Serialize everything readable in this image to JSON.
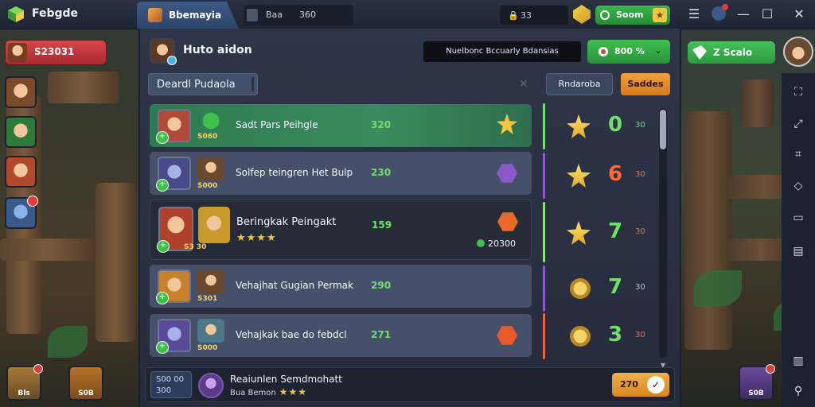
{
  "app": {
    "title": "Febgde"
  },
  "topbar": {
    "active_tab": "Bbemayia",
    "tab2_a": "Baa",
    "tab2_b": "360",
    "coin_value": "33",
    "green_pill_label": "Soom",
    "window_controls": [
      "menu-icon",
      "minimize-icon",
      "maximize-icon",
      "close-icon"
    ]
  },
  "left": {
    "player_value": "S23031",
    "bottom_tiles": [
      {
        "label": "Bls"
      },
      {
        "label": "S0B"
      }
    ]
  },
  "panel": {
    "header_title": "Huto aidon",
    "header_banner": "Nuelbonc Bccuarly Bdansias",
    "header_green_label": "800 %",
    "filter_label": "Deardl Pudaola",
    "btn_dark": "Rndaroba",
    "btn_orange": "Saddes",
    "rows": [
      {
        "hero_label": "S060",
        "name": "Sadt Pars Peihgle",
        "num": "320",
        "badge_color": "#f5c542",
        "style": "hl"
      },
      {
        "hero_label": "S000",
        "name": "Solfep teingren Het Bulp",
        "num": "230",
        "badge_color": "#8a5ac8",
        "style": "normal"
      },
      {
        "hero_label": "S3 30",
        "name": "Beringkak Peingakt",
        "num": "159",
        "stars": "★★★★",
        "gem_value": "20300",
        "badge_color": "#e86a2a",
        "style": "dark"
      },
      {
        "hero_label": "S301",
        "name": "Vehajhat Gugian Permak",
        "num": "290",
        "badge_color": "#e86a2a",
        "style": "normal"
      },
      {
        "hero_label": "S000",
        "name": "Vehajkak bae do febdcl",
        "num": "271",
        "badge_color": "#e85a2a",
        "style": "normal"
      }
    ],
    "scores": [
      {
        "icon": "star",
        "big": "0",
        "small": "30",
        "big_color": "#6ee06a",
        "small_color": "#6ee06a",
        "bar": "#6ee06a"
      },
      {
        "icon": "star",
        "big": "6",
        "small": "30",
        "big_color": "#ff6a3a",
        "small_color": "#ff6a3a",
        "bar": "#8a5ac8"
      },
      {
        "icon": "star",
        "big": "7",
        "small": "30",
        "big_color": "#6ee06a",
        "small_color": "#ff6a3a",
        "bar": "#8ee07a"
      },
      {
        "icon": "coin",
        "big": "7",
        "small": "30",
        "big_color": "#6ee06a",
        "small_color": "#b8c0d0",
        "bar": "#8a5ac8"
      },
      {
        "icon": "coin",
        "big": "3",
        "small": "30",
        "big_color": "#6ee06a",
        "small_color": "#ff6a3a",
        "bar": "#e8643a"
      }
    ],
    "bottom": {
      "box_a": "S00 00",
      "box_b": "300",
      "title": "Reaiunlen Semdmohatt",
      "sub": "Bua Bemon",
      "stars": "★★★",
      "btn_label": "270"
    }
  },
  "right": {
    "pill_label": "Z Scalo",
    "tile_label": "S0B"
  }
}
